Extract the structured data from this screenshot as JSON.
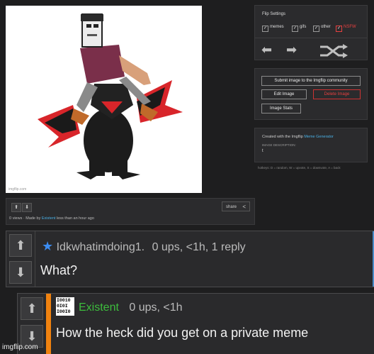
{
  "meme": {
    "watermark": "imgflip.com"
  },
  "image_bar": {
    "share_label": "share",
    "views": "0 views",
    "made_by_prefix": "· Made by",
    "author": "Existent",
    "time": "less than an hour ago"
  },
  "flip_settings": {
    "title": "Flip Settings",
    "options": [
      {
        "label": "memes",
        "checked": true
      },
      {
        "label": "gifs",
        "checked": true
      },
      {
        "label": "other",
        "checked": true
      },
      {
        "label": "NSFW",
        "checked": true
      }
    ]
  },
  "actions": {
    "submit": "Submit image to the Imgflip community",
    "edit": "Edit Image",
    "delete": "Delete Image",
    "stats": "Image Stats"
  },
  "creator": {
    "prefix": "Created with the Imgflip",
    "link": "Meme Generator",
    "desc_label": "IMAGE DESCRIPTION:",
    "desc_value": "t"
  },
  "hotkeys": "hotkeys: D = random, W = upvote, S = downvote, A = back",
  "comments": [
    {
      "username": "Idkwhatimdoing1.",
      "meta": "0 ups, <1h, 1 reply",
      "text": "What?"
    },
    {
      "avatar_text": "I0010\n0I0I\nI00I0",
      "username": "Existent",
      "meta": "0 ups, <1h",
      "text": "How the heck did you get on a private meme"
    }
  ],
  "watermark": "imgflip.com",
  "colors": {
    "background": "#1e1e1f",
    "link": "#4ab0e4",
    "nsfw": "#e84040",
    "reply_accent": "#f0820f",
    "username_green": "#3dbd3d"
  }
}
